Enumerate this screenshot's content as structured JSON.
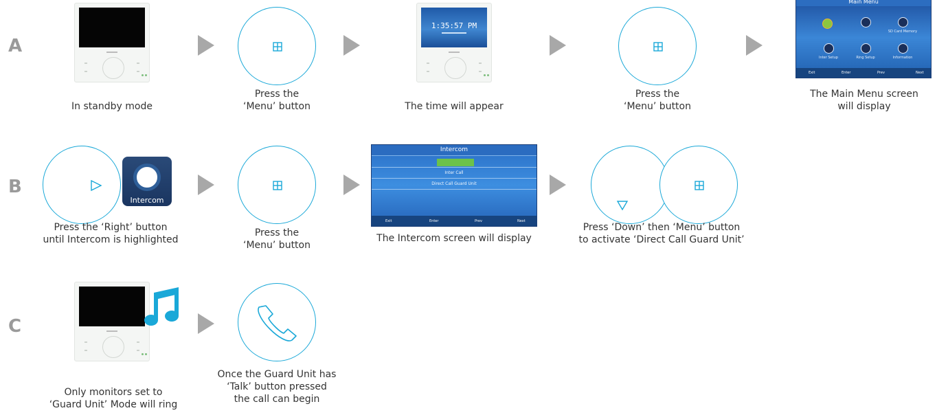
{
  "rows": {
    "a": "A",
    "b": "B",
    "c": "C"
  },
  "steps": {
    "a1": "In standby mode",
    "a2": "Press the\n‘Menu’ button",
    "a3": "The time will appear",
    "a4": "Press the\n‘Menu’ button",
    "a5": "The Main Menu screen\nwill display",
    "b1": "Press the ‘Right’ button\nuntil Intercom is highlighted",
    "b2": "Press the\n‘Menu’ button",
    "b3": "The Intercom screen will display",
    "b4": "Press ‘Down’ then ‘Menu’ button\nto activate ‘Direct Call Guard Unit’",
    "c1": "Only monitors set to\n‘Guard Unit’ Mode will ring",
    "c2": "Once the Guard Unit has\n‘Talk’ button pressed\n the  call can begin"
  },
  "screens": {
    "clock_time": "1:35:57 PM",
    "main_menu": {
      "title": "Main Menu",
      "items": [
        "",
        "",
        "SD Card Memory",
        "Inter Setup",
        "Ring Setup",
        "Information"
      ],
      "footer": [
        "Exit",
        "Enter",
        "Prev",
        "Next"
      ]
    },
    "intercom": {
      "title": "Intercom",
      "rows": [
        "",
        "Inter Call",
        "Direct Call Guard Unit"
      ],
      "footer": [
        "Exit",
        "Enter",
        "Prev",
        "Next"
      ]
    },
    "intercom_tile_label": "Intercom"
  },
  "colors": {
    "accent": "#1aa8d8",
    "arrow": "#a8a8a8",
    "row_letter": "#9a9a9a"
  }
}
